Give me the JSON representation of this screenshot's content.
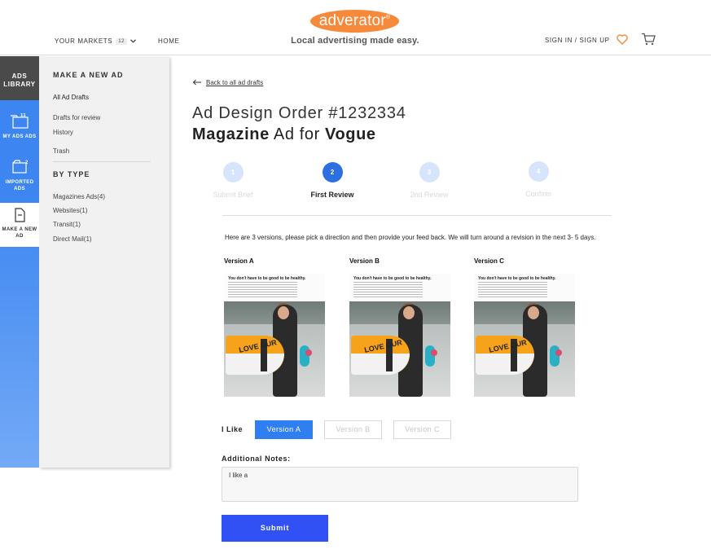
{
  "header": {
    "logo_text": "adverator",
    "logo_mark": "®",
    "tagline": "Local advertising made easy.",
    "markets_label": "YOUR MARKETS",
    "markets_count": "12",
    "home_label": "HOME",
    "signin_label": "SIGN IN / SIGN UP",
    "icons": {
      "favorites": "heart-icon",
      "cart": "cart-icon",
      "markets_dropdown": "chevron-down-icon"
    },
    "accent": "#f6893a"
  },
  "rail": {
    "library_label": "ADS LIBRARY",
    "my_ads": {
      "label": "MY ADS ADS",
      "count": "11",
      "icon": "folder-icon"
    },
    "imported": {
      "label": "IMPORTED ADS",
      "count": "2",
      "icon": "folder-icon"
    },
    "make_new": {
      "label": "MAKE A NEW AD",
      "icon": "document-icon"
    },
    "color": "#3d86f2"
  },
  "sidebar": {
    "section_title": "MAKE A NEW AD",
    "links": [
      "All Ad Drafts",
      "Drafts for review",
      "History",
      "Trash"
    ],
    "type_title": "BY TYPE",
    "types": [
      "Magazines Ads(4)",
      "Websites(1)",
      "Transit(1)",
      "Direct Mail(1)"
    ]
  },
  "main": {
    "back_label": "Back to all ad drafts",
    "order_title": "Ad Design Order #1232334",
    "ad_title": {
      "part1": "Magazine",
      "part2": " Ad for ",
      "part3": "Vogue"
    },
    "steps": [
      {
        "number": "1",
        "label": "Submit Brief",
        "state": "inactive"
      },
      {
        "number": "2",
        "label": "First Review",
        "state": "current"
      },
      {
        "number": "3",
        "label": "2nd Review",
        "state": "inactive"
      },
      {
        "number": "4",
        "label": "Confirm",
        "state": "inactive"
      }
    ],
    "instructions": "Here are 3 versions, please pick a direction and then provide your feed back. We will turn around a revision in the next 3- 5 days.",
    "versions": [
      {
        "label": "Version A",
        "headline": "You don't have to be good to be healthy.",
        "board_text": "LOVE OUR"
      },
      {
        "label": "Version B",
        "headline": "You don't have to be good to be healthy.",
        "board_text": "LOVE OUR"
      },
      {
        "label": "Version C",
        "headline": "You don't have to be good to be healthy.",
        "board_text": "LOVE OUR"
      }
    ],
    "like_label": "I Like",
    "choices": [
      "Version A",
      "Version B",
      "Version C"
    ],
    "selected_choice": "Version A",
    "notes_label": "Additional Notes:",
    "notes_value": "I like a",
    "submit_label": "Submit",
    "colors": {
      "step_active": "#2b6fe0",
      "step_inactive": "#d6e5fb",
      "selected": "#2f7ef2",
      "submit": "#3251f5"
    }
  }
}
